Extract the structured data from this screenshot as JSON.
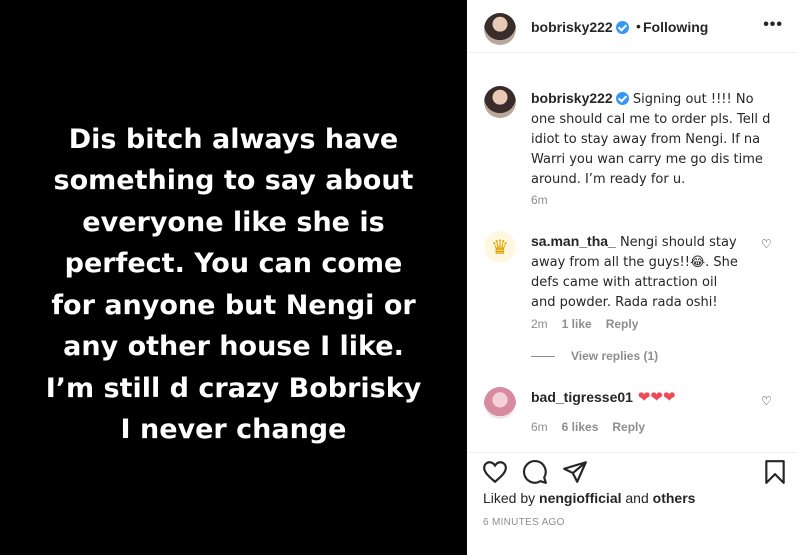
{
  "post": {
    "image_text": "Dis bitch always have\nsomething to say about\neveryone like she is\nperfect. You can come\nfor anyone but Nengi or\nany other house I like.\nI’m still d crazy Bobrisky\nI never change"
  },
  "header": {
    "username": "bobrisky222",
    "separator": "•",
    "follow_state": "Following",
    "more_label": "•••"
  },
  "caption": {
    "username": "bobrisky222",
    "text": " Signing out !!!! No one should cal me to order pls. Tell d idiot to stay away from Nengi. If na Warri you wan carry me go dis time around. I’m ready for u.",
    "time": "6m"
  },
  "comments": [
    {
      "username": "sa.man_tha_",
      "text": " Nengi should stay away from all the guys!!😂. She defs came with attraction oil and powder. Rada rada oshi!",
      "time": "2m",
      "likes": "1 like",
      "reply": "Reply",
      "view_replies": "View replies (1)"
    },
    {
      "username": "bad_tigresse01",
      "text": " ❤❤❤",
      "time": "6m",
      "likes": "6 likes",
      "reply": "Reply"
    }
  ],
  "footer": {
    "liked_prefix": "Liked by ",
    "liked_user": "nengiofficial",
    "liked_and": " and ",
    "liked_others": "others",
    "time_ago": "6 MINUTES AGO"
  },
  "icons": {
    "like": "heart-icon",
    "comment": "comment-icon",
    "share": "share-icon",
    "save": "bookmark-icon"
  },
  "colors": {
    "verified": "#3897f0",
    "heart_red": "#ed4956",
    "muted": "#8e8e8e"
  }
}
